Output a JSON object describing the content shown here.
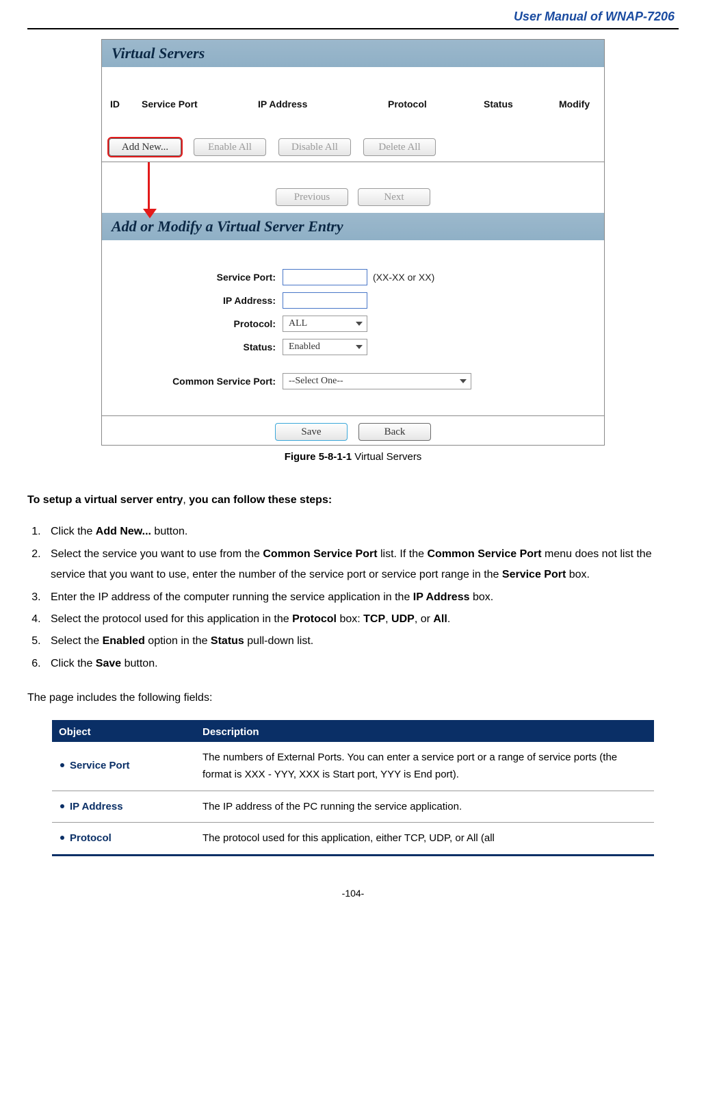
{
  "header": {
    "title": "User Manual of WNAP-7206"
  },
  "panel1": {
    "title": "Virtual Servers",
    "columns": {
      "id": "ID",
      "service_port": "Service Port",
      "ip": "IP Address",
      "protocol": "Protocol",
      "status": "Status",
      "modify": "Modify"
    },
    "buttons": {
      "add_new": "Add New...",
      "enable_all": "Enable All",
      "disable_all": "Disable All",
      "delete_all": "Delete All",
      "previous": "Previous",
      "next": "Next"
    }
  },
  "panel2": {
    "title": "Add or Modify a Virtual Server Entry",
    "labels": {
      "service_port": "Service Port:",
      "ip": "IP Address:",
      "protocol": "Protocol:",
      "status": "Status:",
      "common": "Common Service Port:"
    },
    "hint": "(XX-XX or XX)",
    "values": {
      "service_port": "",
      "ip": "",
      "protocol": "ALL",
      "status": "Enabled",
      "common": "--Select One--"
    },
    "buttons": {
      "save": "Save",
      "back": "Back"
    }
  },
  "caption": {
    "fig": "Figure 5-8-1-1",
    "text": " Virtual Servers"
  },
  "intro": {
    "lead": "To setup a virtual server entry",
    "sep": ", ",
    "lead2": "you can follow these steps:"
  },
  "steps": {
    "s1a": "Click the ",
    "s1b": "Add New...",
    "s1c": " button.",
    "s2a": "Select the service you want to use from the ",
    "s2b": "Common Service Port",
    "s2c": " list. If the ",
    "s2d": "Common Service Port",
    "s2e": " menu does not list the service that you want to use, enter the number of the service port or service port range in the ",
    "s2f": "Service Port",
    "s2g": " box.",
    "s3a": "Enter the IP address of the computer running the service application in the ",
    "s3b": "IP Address",
    "s3c": " box.",
    "s4a": "Select the protocol used for this application in the ",
    "s4b": "Protocol",
    "s4c": " box: ",
    "s4d": "TCP",
    "s4e": ", ",
    "s4f": "UDP",
    "s4g": ", or ",
    "s4h": "All",
    "s4i": ".",
    "s5a": "Select the ",
    "s5b": "Enabled",
    "s5c": " option in the ",
    "s5d": "Status",
    "s5e": " pull-down list.",
    "s6a": "Click the ",
    "s6b": "Save",
    "s6c": " button."
  },
  "fields_intro": "The page includes the following fields:",
  "table": {
    "head": {
      "object": "Object",
      "desc": "Description"
    },
    "rows": [
      {
        "object": "Service Port",
        "desc": "The numbers of External Ports. You can enter a service port or a range of service ports (the format is XXX - YYY, XXX is Start port, YYY is End port)."
      },
      {
        "object": "IP Address",
        "desc": "The IP address of the PC running the service application."
      },
      {
        "object": "Protocol",
        "desc": "The protocol used for this application, either TCP, UDP, or All (all"
      }
    ]
  },
  "page_num": "-104-"
}
